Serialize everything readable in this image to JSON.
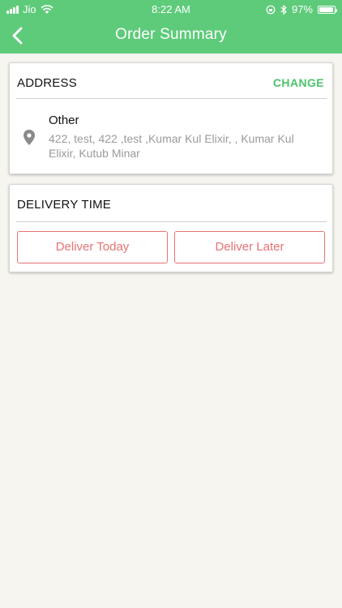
{
  "status_bar": {
    "carrier": "Jio",
    "time": "8:22 AM",
    "battery": "97%",
    "battery_level": 0.97
  },
  "header": {
    "title": "Order Summary",
    "back_icon": "chevron-left-icon"
  },
  "address": {
    "heading": "ADDRESS",
    "change_label": "CHANGE",
    "type": "Other",
    "text": "422, test, 422 ,test ,Kumar Kul Elixir, , Kumar Kul Elixir, Kutub Minar",
    "icon": "location-pin-icon"
  },
  "delivery": {
    "heading": "DELIVERY TIME",
    "today_label": "Deliver Today",
    "later_label": "Deliver Later"
  },
  "colors": {
    "header_bg": "#5ecb7a",
    "accent_green": "#4cc46a",
    "button_red": "#e57373",
    "page_bg": "#f7f5f0"
  }
}
